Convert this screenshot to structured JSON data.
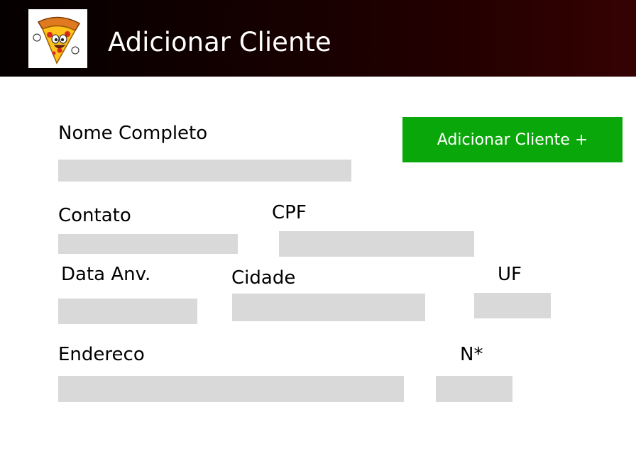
{
  "header": {
    "title": "Adicionar Cliente",
    "logo_icon": "pizza-mascot-icon",
    "gradient_colors": [
      "#050000",
      "#350202"
    ]
  },
  "actions": {
    "add_button_label": "Adicionar Cliente +",
    "add_button_color": "#0aa70a"
  },
  "form": {
    "field_color": "#d9d9d9",
    "nome": {
      "label": "Nome Completo",
      "value": ""
    },
    "contato": {
      "label": "Contato",
      "value": ""
    },
    "cpf": {
      "label": "CPF",
      "value": ""
    },
    "data_anv": {
      "label": "Data Anv.",
      "value": ""
    },
    "cidade": {
      "label": "Cidade",
      "value": ""
    },
    "uf": {
      "label": "UF",
      "value": ""
    },
    "endereco": {
      "label": "Endereco",
      "value": ""
    },
    "numero": {
      "label": "N*",
      "value": ""
    }
  }
}
